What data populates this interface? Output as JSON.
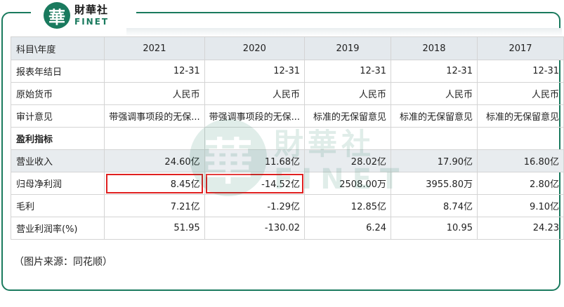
{
  "brand": {
    "logo_char": "華",
    "name_cn": "財華社",
    "name_en": "FINET"
  },
  "watermark": {
    "char": "華",
    "cn": "財華社",
    "en": "FINET"
  },
  "table": {
    "header": [
      "科目\\年度",
      "2021",
      "2020",
      "2019",
      "2018",
      "2017"
    ],
    "rows": [
      {
        "label": "报表年结日",
        "values": [
          "12-31",
          "12-31",
          "12-31",
          "12-31",
          "12-31"
        ]
      },
      {
        "label": "原始货币",
        "values": [
          "人民币",
          "人民币",
          "人民币",
          "人民币",
          "人民币"
        ]
      },
      {
        "label": "审计意见",
        "values": [
          "带强调事项段的无保...",
          "带强调事项段的无保...",
          "标准的无保留意见",
          "标准的无保留意见",
          "标准的无保留意见"
        ]
      },
      {
        "label": "盈利指标",
        "values": [
          "",
          "",
          "",
          "",
          ""
        ]
      },
      {
        "label": "营业收入",
        "values": [
          "24.60亿",
          "11.68亿",
          "28.02亿",
          "17.90亿",
          "16.80亿"
        ]
      },
      {
        "label": "归母净利润",
        "values": [
          "8.45亿",
          "-14.52亿",
          "2508.00万",
          "3955.80万",
          "2.80亿"
        ]
      },
      {
        "label": "毛利",
        "values": [
          "7.21亿",
          "-1.29亿",
          "12.85亿",
          "8.74亿",
          "9.10亿"
        ]
      },
      {
        "label": "营业利润率(%)",
        "values": [
          "51.95",
          "-130.02",
          "6.24",
          "10.95",
          "24.23"
        ]
      }
    ]
  },
  "highlight_color": "#e02020",
  "accent_color": "#1a7a5e",
  "source": "（图片来源：同花顺）"
}
